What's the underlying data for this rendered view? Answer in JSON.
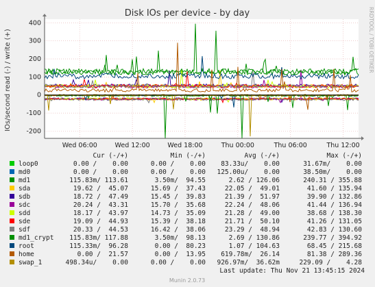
{
  "chart_data": {
    "type": "line",
    "title": "Disk IOs per device - by day",
    "ylabel": "IOs/second read (-) / write (+)",
    "side_label": "RRDTOOL / TOBI OETIKER",
    "ylim": [
      -240,
      420
    ],
    "yticks": [
      400,
      300,
      200,
      100,
      0,
      -100,
      -200
    ],
    "ytick_labels": [
      "400",
      "300",
      "200",
      "100",
      "0",
      "-100",
      "-200"
    ],
    "xticks": [
      "Wed 06:00",
      "Wed 12:00",
      "Wed 18:00",
      "Thu 00:00",
      "Thu 06:00",
      "Thu 12:00"
    ],
    "x_range_hours": [
      "Wed 02:00",
      "Thu 13:45"
    ],
    "grid": true,
    "legend_placement": "bottom",
    "legend_header": [
      "Cur (-/+)",
      "Min (-/+)",
      "Avg (-/+)",
      "Max (-/+)"
    ],
    "series": [
      {
        "name": "loop0",
        "color": "#00cc00",
        "cur": "0.00 /    0.00",
        "min": "0.00 /    0.00",
        "avg": "83.33u/    0.00",
        "max": "31.67m/    0.00"
      },
      {
        "name": "md0",
        "color": "#0066b3",
        "cur": "0.00 /    0.00",
        "min": "0.00 /    0.00",
        "avg": "125.00u/    0.00",
        "max": "38.50m/    0.00"
      },
      {
        "name": "md1",
        "color": "#008f00",
        "cur": "115.83m/ 113.61",
        "min": "3.50m/  94.55",
        "avg": "2.62 / 126.06",
        "max": "240.31 / 355.88"
      },
      {
        "name": "sda",
        "color": "#ffcc00",
        "cur": "19.62 /  45.07",
        "min": "15.69 /  37.43",
        "avg": "22.05 /  49.01",
        "max": "41.60 / 135.94"
      },
      {
        "name": "sdb",
        "color": "#330099",
        "cur": "18.72 /  47.49",
        "min": "15.45 /  39.83",
        "avg": "21.39 /  51.97",
        "max": "39.90 / 132.86"
      },
      {
        "name": "sdc",
        "color": "#990099",
        "cur": "20.24 /  43.31",
        "min": "15.70 /  35.68",
        "avg": "22.24 /  48.06",
        "max": "41.44 / 136.94"
      },
      {
        "name": "sdd",
        "color": "#ccff00",
        "cur": "18.17 /  43.97",
        "min": "14.73 /  35.09",
        "avg": "21.28 /  49.00",
        "max": "38.68 / 138.30"
      },
      {
        "name": "sde",
        "color": "#ff0000",
        "cur": "19.09 /  44.93",
        "min": "15.39 /  38.18",
        "avg": "21.71 /  50.10",
        "max": "41.26 / 131.05"
      },
      {
        "name": "sdf",
        "color": "#808080",
        "cur": "20.33 /  44.53",
        "min": "16.42 /  38.06",
        "avg": "23.29 /  48.94",
        "max": "42.83 / 130.60"
      },
      {
        "name": "md1_crypt",
        "color": "#008f00",
        "cur": "115.83m/ 117.88",
        "min": "3.50m/  98.13",
        "avg": "2.69 / 130.86",
        "max": "239.77 / 394.92"
      },
      {
        "name": "root",
        "color": "#00487d",
        "cur": "115.33m/  96.28",
        "min": "0.00 /  80.23",
        "avg": "1.07 / 104.63",
        "max": "68.45 / 215.68"
      },
      {
        "name": "home",
        "color": "#b35a00",
        "cur": "0.00 /  21.57",
        "min": "0.00 /  13.95",
        "avg": "619.78m/  26.14",
        "max": "81.38 / 289.36"
      },
      {
        "name": "swap_1",
        "color": "#b38f00",
        "cur": "498.34u/    0.00",
        "min": "0.00 /    0.00",
        "avg": "926.97m/  36.62m",
        "max": "229.09 /    4.28"
      }
    ],
    "last_update": "Last update: Thu Nov 21 13:45:15 2024",
    "footer": "Munin 2.0.73"
  }
}
